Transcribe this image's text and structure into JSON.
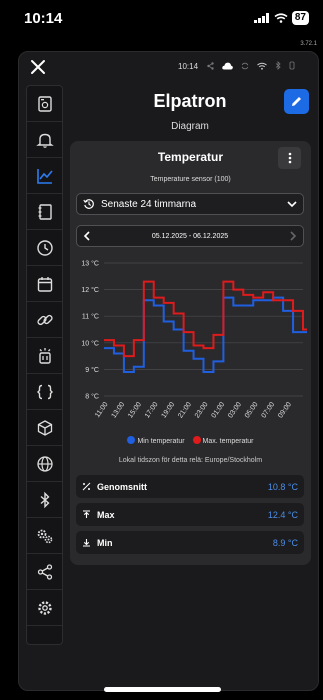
{
  "status_bar": {
    "time": "10:14",
    "battery": "87"
  },
  "version": "3.72.1",
  "inner_status": {
    "time": "10:14"
  },
  "header": {
    "title": "Elpatron",
    "subtitle": "Diagram"
  },
  "nav": {
    "items": [
      {
        "name": "device-icon"
      },
      {
        "name": "bell-icon"
      },
      {
        "name": "chart-icon",
        "active": true
      },
      {
        "name": "notebook-icon"
      },
      {
        "name": "clock-icon"
      },
      {
        "name": "calendar-icon"
      },
      {
        "name": "link-icon"
      },
      {
        "name": "relay-icon"
      },
      {
        "name": "code-braces-icon"
      },
      {
        "name": "cube-icon"
      },
      {
        "name": "globe-icon"
      },
      {
        "name": "bluetooth-icon"
      },
      {
        "name": "gears-icon"
      },
      {
        "name": "share-icon"
      },
      {
        "name": "settings-icon"
      }
    ]
  },
  "card": {
    "title": "Temperatur",
    "sensor": "Temperature sensor (100)",
    "range_label": "Senaste 24 timmarna",
    "date_range": "05.12.2025 - 06.12.2025",
    "timezone": "Lokal tidszon för detta relä: Europe/Stockholm"
  },
  "colors": {
    "accent": "#1d6ae5",
    "min_series": "#1f5fe0",
    "max_series": "#e01b1b",
    "value_text": "#4b8ee8"
  },
  "chart_data": {
    "type": "line",
    "x": [
      "11:00",
      "13:00",
      "15:00",
      "17:00",
      "19:00",
      "21:00",
      "23:00",
      "01:00",
      "03:00",
      "05:00",
      "07:00",
      "09:00"
    ],
    "ylim": [
      8,
      13
    ],
    "yticks": [
      "13 °C",
      "12 °C",
      "11 °C",
      "10 °C",
      "9 °C",
      "8 °C"
    ],
    "legend": [
      "Min temperatur",
      "Max. temperatur"
    ],
    "grid": true,
    "series": [
      {
        "name": "Min temperatur",
        "color": "#1f5fe0",
        "step": true,
        "points": [
          [
            0,
            9.8
          ],
          [
            1,
            9.6
          ],
          [
            2,
            8.9
          ],
          [
            3,
            9.1
          ],
          [
            4,
            11.6
          ],
          [
            5,
            11.4
          ],
          [
            6,
            10.8
          ],
          [
            7,
            10.5
          ],
          [
            8,
            9.7
          ],
          [
            9,
            9.4
          ],
          [
            10,
            8.9
          ],
          [
            11,
            9.3
          ],
          [
            12,
            11.7
          ],
          [
            13,
            11.4
          ],
          [
            14,
            11.4
          ],
          [
            15,
            11.6
          ],
          [
            16,
            11.6
          ],
          [
            17,
            11.7
          ],
          [
            18,
            11.2
          ],
          [
            19,
            10.4
          ],
          [
            20,
            10.4
          ]
        ]
      },
      {
        "name": "Max. temperatur",
        "color": "#e01b1b",
        "step": true,
        "points": [
          [
            0,
            10.1
          ],
          [
            1,
            9.9
          ],
          [
            2,
            9.5
          ],
          [
            3,
            10.1
          ],
          [
            4,
            12.3
          ],
          [
            5,
            11.7
          ],
          [
            6,
            11.5
          ],
          [
            7,
            11.1
          ],
          [
            8,
            10.4
          ],
          [
            9,
            9.9
          ],
          [
            10,
            9.8
          ],
          [
            11,
            10.3
          ],
          [
            12,
            12.3
          ],
          [
            13,
            12.0
          ],
          [
            14,
            11.8
          ],
          [
            15,
            11.7
          ],
          [
            16,
            11.9
          ],
          [
            17,
            11.6
          ],
          [
            18,
            11.6
          ],
          [
            19,
            11.2
          ],
          [
            20,
            10.5
          ]
        ]
      }
    ]
  },
  "stats": [
    {
      "label": "Genomsnitt",
      "value": "10.8 °C",
      "icon": "percent-icon"
    },
    {
      "label": "Max",
      "value": "12.4 °C",
      "icon": "arrow-up-bar-icon"
    },
    {
      "label": "Min",
      "value": "8.9 °C",
      "icon": "arrow-down-bar-icon"
    }
  ]
}
